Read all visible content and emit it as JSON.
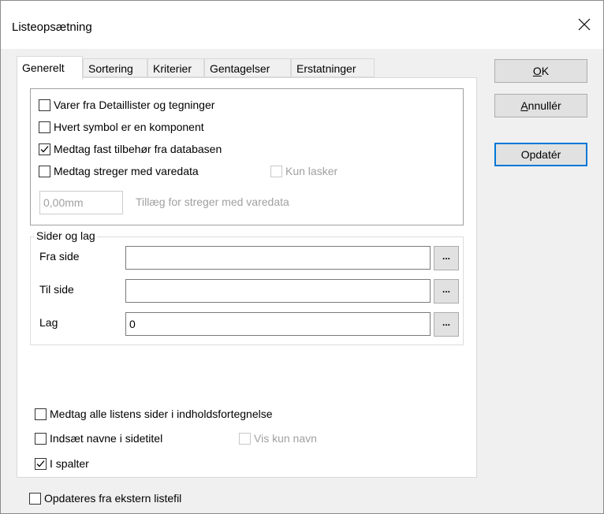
{
  "window": {
    "title": "Listeopsætning"
  },
  "tabs": [
    {
      "label": "Generelt",
      "active": true
    },
    {
      "label": "Sortering",
      "active": false
    },
    {
      "label": "Kriterier",
      "active": false
    },
    {
      "label": "Gentagelser",
      "active": false
    },
    {
      "label": "Erstatninger",
      "active": false
    }
  ],
  "general": {
    "items_from_lists": {
      "label": "Varer fra Detaillister og tegninger",
      "checked": false
    },
    "each_symbol_component": {
      "label": "Hvert symbol er en komponent",
      "checked": false
    },
    "include_accessories": {
      "label": "Medtag fast tilbehør fra databasen",
      "checked": true
    },
    "include_lines": {
      "label": "Medtag streger med varedata",
      "checked": false
    },
    "only_splices": {
      "label": "Kun lasker",
      "checked": false,
      "enabled": false
    },
    "line_addition": {
      "value": "0,00mm",
      "label": "Tillæg for streger med varedata",
      "enabled": false
    }
  },
  "pages_layers": {
    "legend": "Sider og lag",
    "from_page": {
      "label": "Fra side",
      "value": ""
    },
    "to_page": {
      "label": "Til side",
      "value": ""
    },
    "layer": {
      "label": "Lag",
      "value": "0"
    },
    "browse_label": "..."
  },
  "toc": {
    "include_all_pages": {
      "label": "Medtag alle listens sider i indholdsfortegnelse",
      "checked": false
    },
    "insert_names": {
      "label": "Indsæt navne i sidetitel",
      "checked": false
    },
    "show_only_name": {
      "label": "Vis kun navn",
      "checked": false,
      "enabled": false
    },
    "in_columns": {
      "label": "I spalter",
      "checked": true
    }
  },
  "external": {
    "label": "Opdateres fra ekstern listefil",
    "checked": false
  },
  "buttons": {
    "ok_mnemonic": "O",
    "ok_rest": "K",
    "cancel_mnemonic": "A",
    "cancel_rest": "nnullér",
    "update": "Opdatér"
  },
  "icons": {
    "close": "close-icon",
    "check": "checkmark-icon"
  }
}
